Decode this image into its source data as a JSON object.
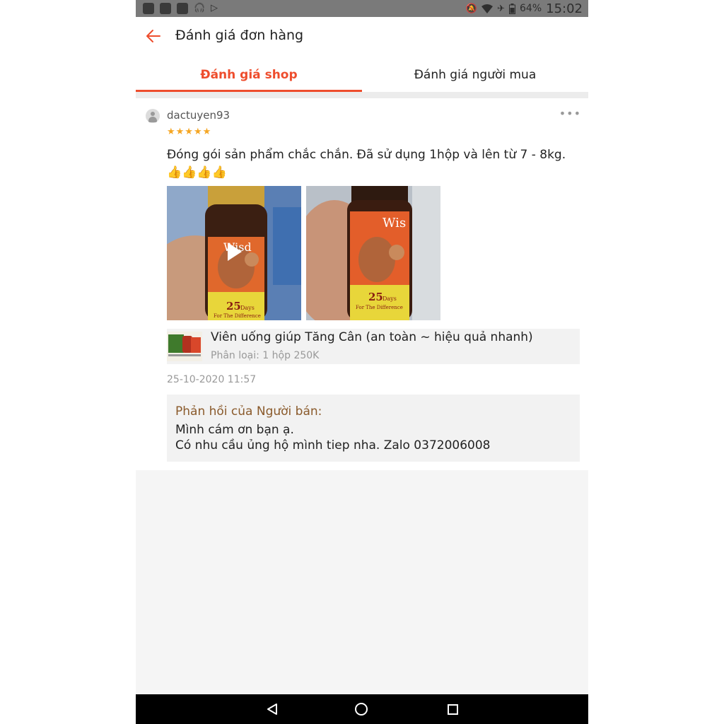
{
  "status_bar": {
    "battery": "64%",
    "time": "15:02",
    "icons": [
      "notification-square",
      "notification-square",
      "notification-square",
      "headset-icon",
      "play-store-icon",
      "mute-icon",
      "wifi-icon",
      "airplane-icon",
      "battery-icon"
    ]
  },
  "header": {
    "title": "Đánh giá đơn hàng",
    "back_icon": "arrow-left-icon"
  },
  "tabs": [
    {
      "label": "Đánh giá shop",
      "active": true
    },
    {
      "label": "Đánh giá người mua",
      "active": false
    }
  ],
  "review": {
    "username": "dactuyen93",
    "rating": 5,
    "stars": "★★★★★",
    "more": "•••",
    "comment": "Đóng gói sản phẩm chắc chắn. Đã sử dụng 1hộp và lên từ 7 - 8kg. 👍👍👍👍",
    "media": [
      {
        "type": "video",
        "label_on_bottle": "Wisd",
        "days": "25",
        "days_label": "Days",
        "tagline": "For The Difference"
      },
      {
        "type": "image",
        "label_on_bottle": "Wis",
        "days": "25",
        "days_label": "Days",
        "tagline": "For The Difference"
      }
    ],
    "product": {
      "name": "Viên uống giúp Tăng Cân (an toàn ~ hiệu quả nhanh)",
      "variant": "Phân loại: 1 hộp 250K"
    },
    "date": "25-10-2020 11:57",
    "seller_reply": {
      "title": "Phản hồi của Người bán:",
      "line1": "Mình cám ơn bạn ạ.",
      "line2": "Có nhu cầu ủng hộ mình tiep nha. Zalo 0372006008"
    }
  },
  "colors": {
    "accent": "#ee4d2d",
    "reply_title": "#8a5a2b",
    "star": "#f5a623"
  }
}
